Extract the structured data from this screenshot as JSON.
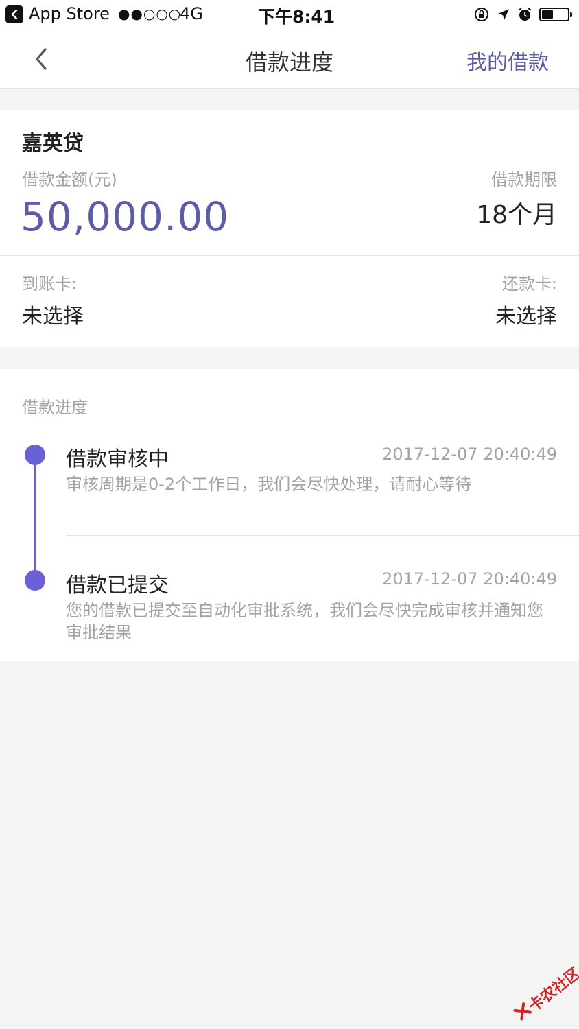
{
  "status_bar": {
    "back_app_label": "App Store",
    "signal": "●●○○○",
    "network": "4G",
    "time": "下午8:41"
  },
  "nav": {
    "title": "借款进度",
    "right_link": "我的借款"
  },
  "loan": {
    "product_name": "嘉英贷",
    "amount_label": "借款金额(元)",
    "amount": "50,000.00",
    "term_label": "借款期限",
    "term": "18个月",
    "receive_card_label": "到账卡:",
    "receive_card_value": "未选择",
    "repay_card_label": "还款卡:",
    "repay_card_value": "未选择"
  },
  "progress": {
    "section_title": "借款进度",
    "steps": [
      {
        "title": "借款审核中",
        "time": "2017-12-07 20:40:49",
        "desc": "审核周期是0-2个工作日，我们会尽快处理，请耐心等待"
      },
      {
        "title": "借款已提交",
        "time": "2017-12-07 20:40:49",
        "desc": "您的借款已提交至自动化审批系统，我们会尽快完成审核并通知您审批结果"
      }
    ]
  },
  "watermark": {
    "text": "卡农社区"
  },
  "colors": {
    "accent": "#5c5ca8",
    "timeline": "#6a61d4",
    "muted_text": "#a3a3a3",
    "background": "#f4f4f4"
  }
}
